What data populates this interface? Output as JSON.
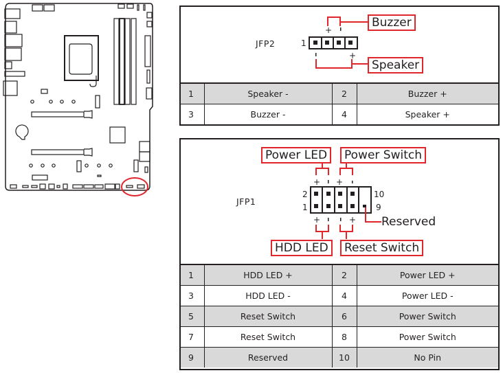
{
  "board": {
    "description": "Motherboard layout with front panel header location highlighted",
    "highlight_color": "#e0252b"
  },
  "jfp2": {
    "connector_label": "JFP2",
    "pin_start_label": "1",
    "callouts": {
      "buzzer": "Buzzer",
      "speaker": "Speaker"
    },
    "polarity": {
      "plus": "+",
      "minus": "-"
    },
    "rows": [
      {
        "pin_a": "1",
        "signal_a": "Speaker -",
        "pin_b": "2",
        "signal_b": "Buzzer +",
        "shaded": true
      },
      {
        "pin_a": "3",
        "signal_a": "Buzzer -",
        "pin_b": "4",
        "signal_b": "Speaker +",
        "shaded": false
      }
    ]
  },
  "jfp1": {
    "connector_label": "JFP1",
    "pin_labels": {
      "top_left": "2",
      "bottom_left": "1",
      "top_right": "10",
      "bottom_right": "9"
    },
    "callouts": {
      "power_led": "Power LED",
      "power_switch": "Power Switch",
      "hdd_led": "HDD LED",
      "reset_switch": "Reset Switch",
      "reserved": "Reserved"
    },
    "polarity": {
      "plus": "+",
      "minus": "-"
    },
    "rows": [
      {
        "pin_a": "1",
        "signal_a": "HDD LED +",
        "pin_b": "2",
        "signal_b": "Power LED +",
        "shaded": true
      },
      {
        "pin_a": "3",
        "signal_a": "HDD LED -",
        "pin_b": "4",
        "signal_b": "Power LED -",
        "shaded": false
      },
      {
        "pin_a": "5",
        "signal_a": "Reset Switch",
        "pin_b": "6",
        "signal_b": "Power Switch",
        "shaded": true
      },
      {
        "pin_a": "7",
        "signal_a": "Reset Switch",
        "pin_b": "8",
        "signal_b": "Power Switch",
        "shaded": false
      },
      {
        "pin_a": "9",
        "signal_a": "Reserved",
        "pin_b": "10",
        "signal_b": "No Pin",
        "shaded": true
      }
    ]
  },
  "colors": {
    "accent": "#e0252b",
    "line": "#231f20",
    "shade": "#d9d9d9"
  }
}
